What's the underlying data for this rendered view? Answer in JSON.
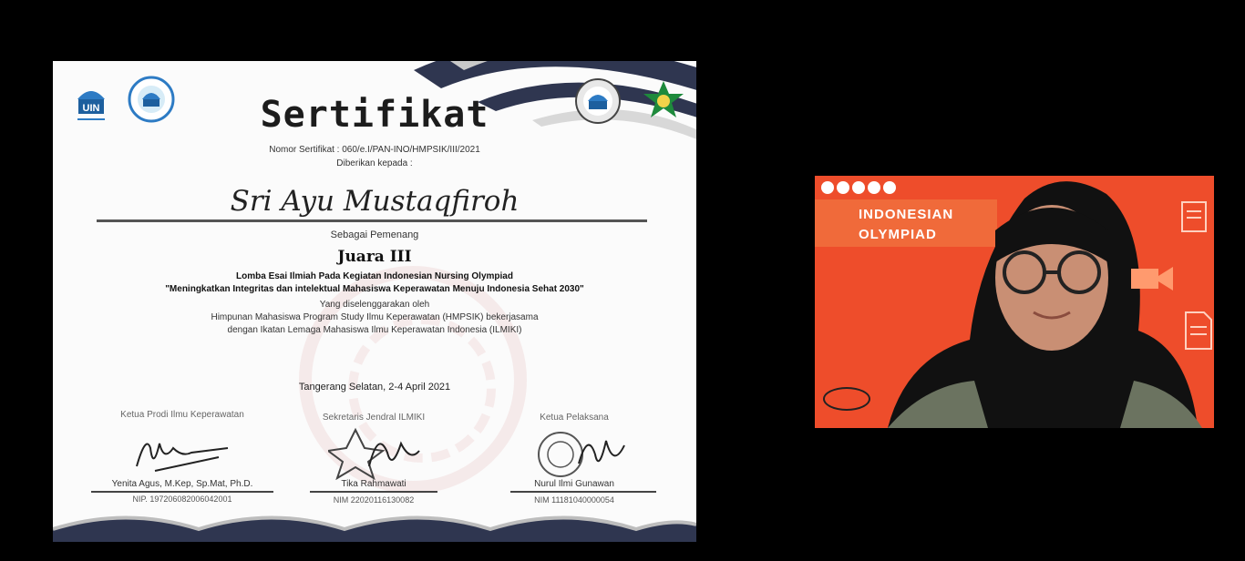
{
  "certificate": {
    "title": "Sertifikat",
    "number": "Nomor Sertifikat : 060/e.I/PAN-INO/HMPSIK/III/2021",
    "given_to": "Diberikan kepada :",
    "recipient": "Sri Ayu Mustaqfiroh",
    "winner_label": "Sebagai Pemenang",
    "rank": "Juara III",
    "competition": "Lomba Esai Ilmiah Pada Kegiatan Indonesian Nursing Olympiad",
    "theme": "\"Meningkatkan Integritas dan intelektual Mahasiswa  Keperawatan Menuju Indonesia Sehat 2030\"",
    "organized_by": "Yang diselenggarakan oleh",
    "organizer_line1": "Himpunan Mahasiswa Program Study Ilmu Keperawatan (HMPSIK) bekerjasama",
    "organizer_line2": "dengan Ikatan Lemaga Mahasiswa Ilmu Keperawatan Indonesia (ILMIKI)",
    "place_date": "Tangerang Selatan, 2-4 April 2021",
    "logo_text": "UIN",
    "signatories": [
      {
        "role": "Ketua Prodi Ilmu Keperawatan",
        "name": "Yenita Agus, M.Kep, Sp.Mat, Ph.D.",
        "id": "NIP. 197206082006042001"
      },
      {
        "role": "Sekretaris Jendral ILMIKI",
        "name": "Tika Rahmawati",
        "id": "NIM 22020116130082"
      },
      {
        "role": "Ketua Pelaksana",
        "name": "Nurul Ilmi Gunawan",
        "id": "NIM 11181040000054"
      }
    ]
  },
  "webcam": {
    "banner_line1": "INDONESIAN",
    "banner_line2": "OLYMPIAD",
    "icons": [
      "notepad-icon",
      "video-camera-icon",
      "document-icon"
    ]
  },
  "colors": {
    "background": "#000000",
    "webcam_bg": "#ee4d2b",
    "cert_navy": "#2f3650"
  }
}
